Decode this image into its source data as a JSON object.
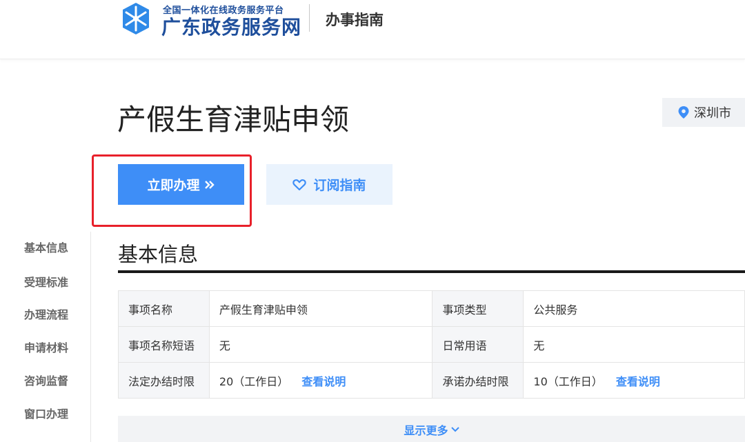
{
  "header": {
    "logo_subtitle": "全国一体化在线政务服务平台",
    "logo_title": "广东政务服务网",
    "section": "办事指南"
  },
  "page": {
    "title": "产假生育津贴申领",
    "location": "深圳市"
  },
  "actions": {
    "apply_label": "立即办理",
    "subscribe_label": "订阅指南"
  },
  "sidebar": {
    "items": [
      {
        "label": "基本信息"
      },
      {
        "label": "受理标准"
      },
      {
        "label": "办理流程"
      },
      {
        "label": "申请材料"
      },
      {
        "label": "咨询监督"
      },
      {
        "label": "窗口办理"
      }
    ]
  },
  "basic_info": {
    "title": "基本信息",
    "rows": [
      {
        "k1": "事项名称",
        "v1": "产假生育津贴申领",
        "k2": "事项类型",
        "v2": "公共服务"
      },
      {
        "k1": "事项名称短语",
        "v1": "无",
        "k2": "日常用语",
        "v2": "无"
      },
      {
        "k1": "法定办结时限",
        "v1": "20（工作日）",
        "link1": "查看说明",
        "k2": "承诺办结时限",
        "v2": "10（工作日）",
        "link2": "查看说明"
      }
    ],
    "show_more": "显示更多"
  },
  "colors": {
    "accent": "#3e8ef7",
    "brand": "#1f4f9c",
    "highlight": "#e8202a"
  }
}
